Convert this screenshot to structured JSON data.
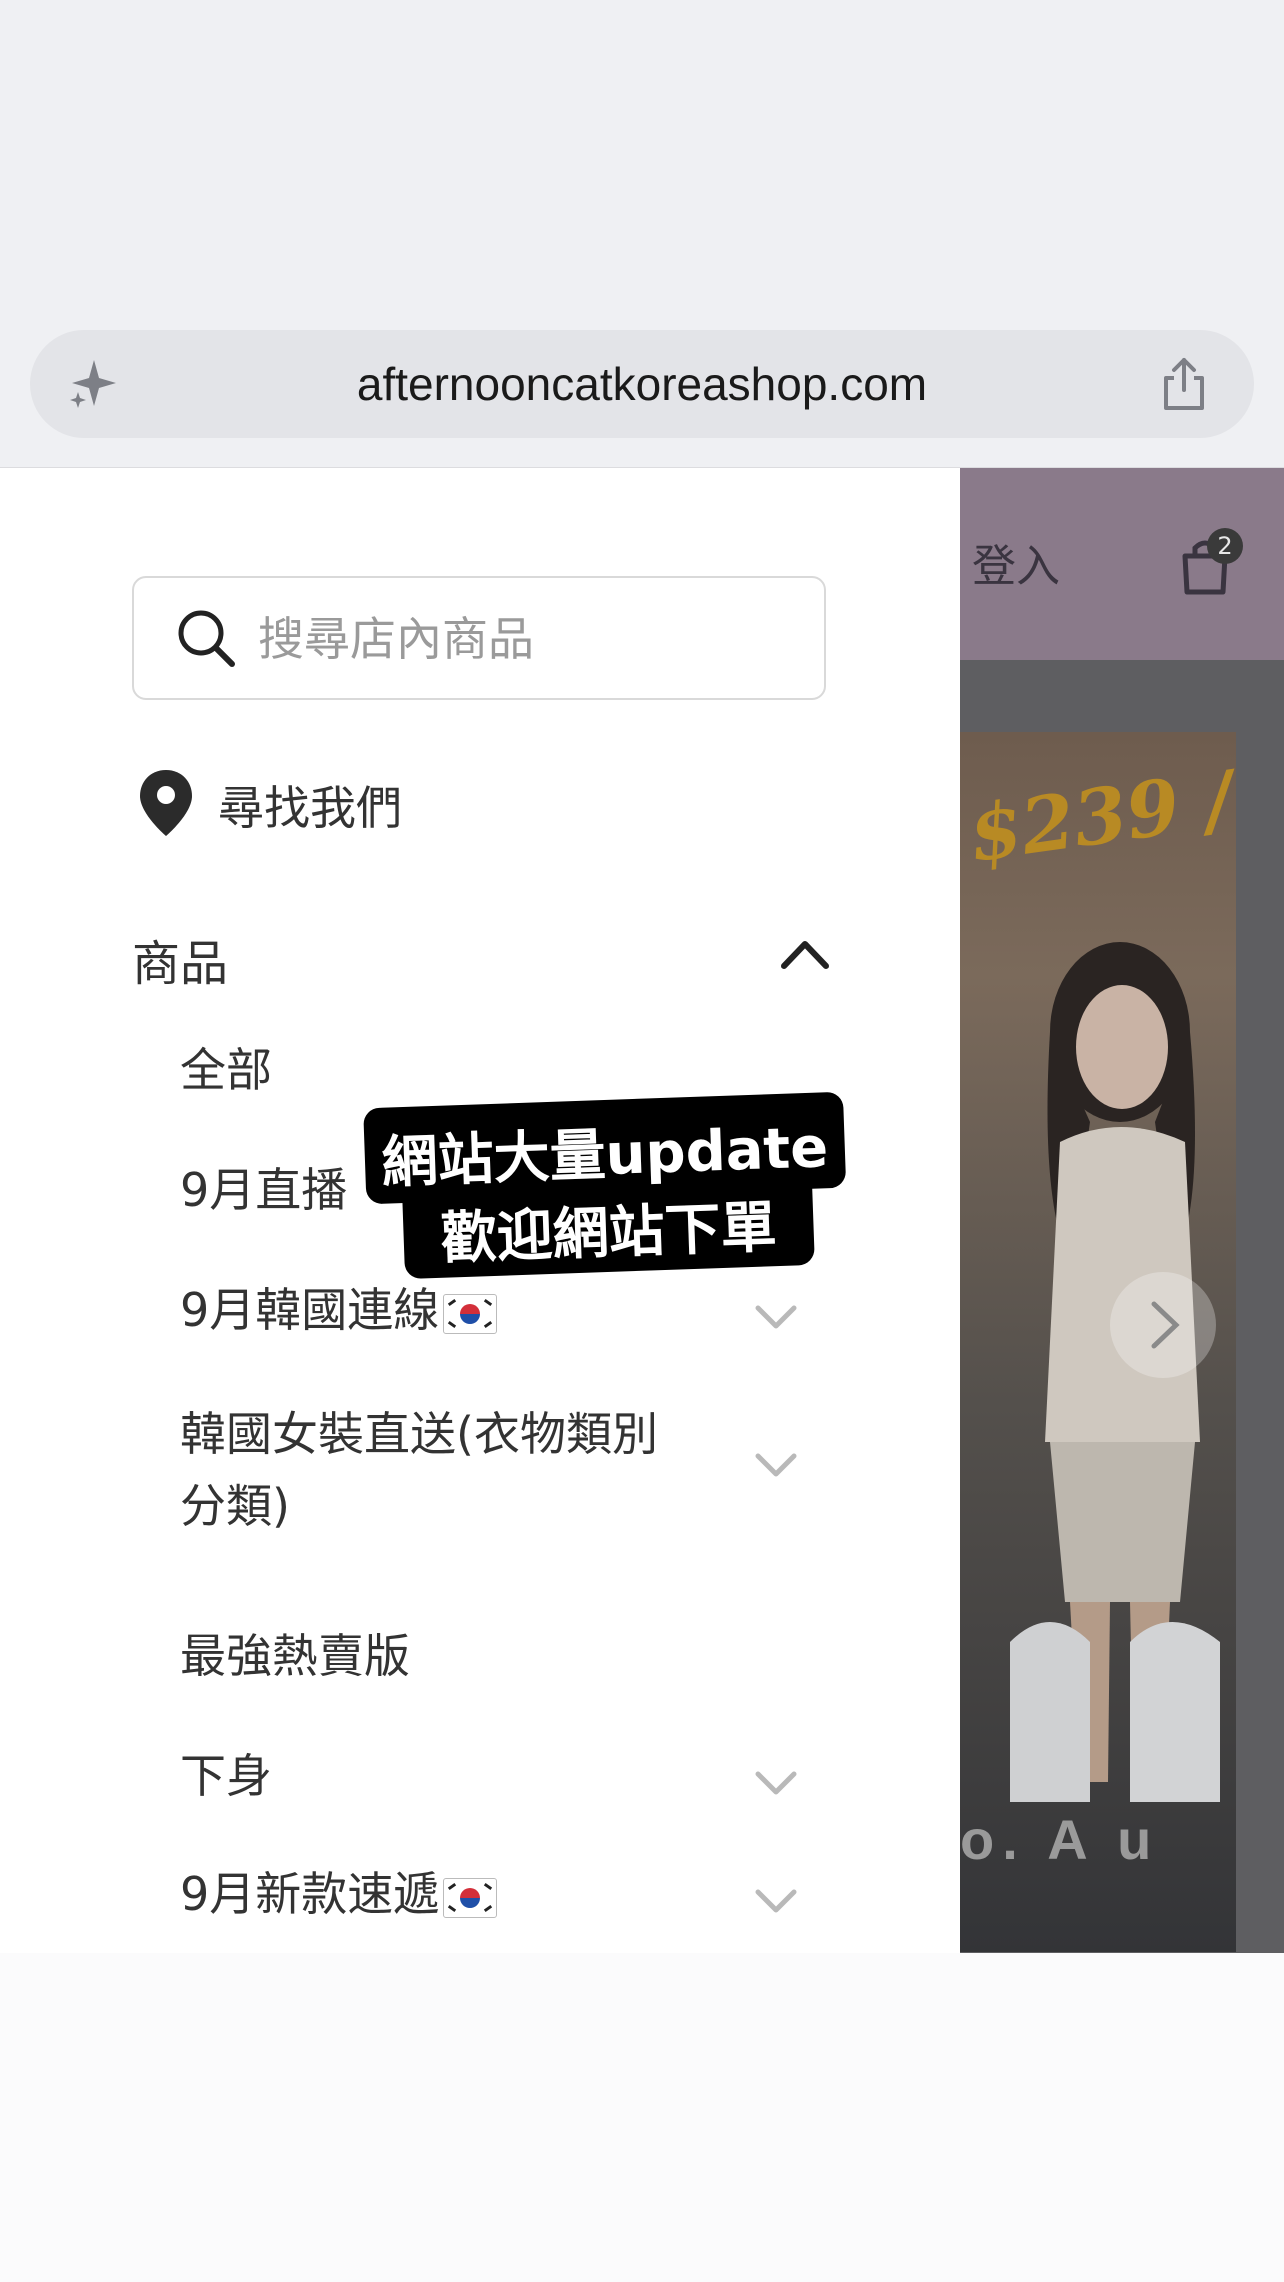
{
  "browser": {
    "url": "afternooncatkoreashop.com",
    "ai_icon": "sparkle-icon",
    "share_icon": "share-icon"
  },
  "site_header": {
    "login_label": "登入",
    "cart_count": "2"
  },
  "banner": {
    "price_text": "$239 /",
    "caption": "o. A u"
  },
  "drawer": {
    "search": {
      "placeholder": "搜尋店內商品"
    },
    "find_us": "尋找我們",
    "products": {
      "label": "商品",
      "items": [
        {
          "label": "全部",
          "expandable": false
        },
        {
          "label": "9月直播",
          "expandable": false
        },
        {
          "label": "9月韓國連線",
          "flag": "kr",
          "expandable": true
        },
        {
          "label": "韓國女裝直送(衣物類別分類)",
          "expandable": true
        },
        {
          "label": "最強熱賣版",
          "expandable": false
        },
        {
          "label": "下身",
          "expandable": true
        },
        {
          "label": "9月新款速遞",
          "flag": "kr",
          "expandable": true
        }
      ]
    }
  },
  "sticker": {
    "line1": "網站大量update",
    "line2": "歡迎網站下單"
  }
}
